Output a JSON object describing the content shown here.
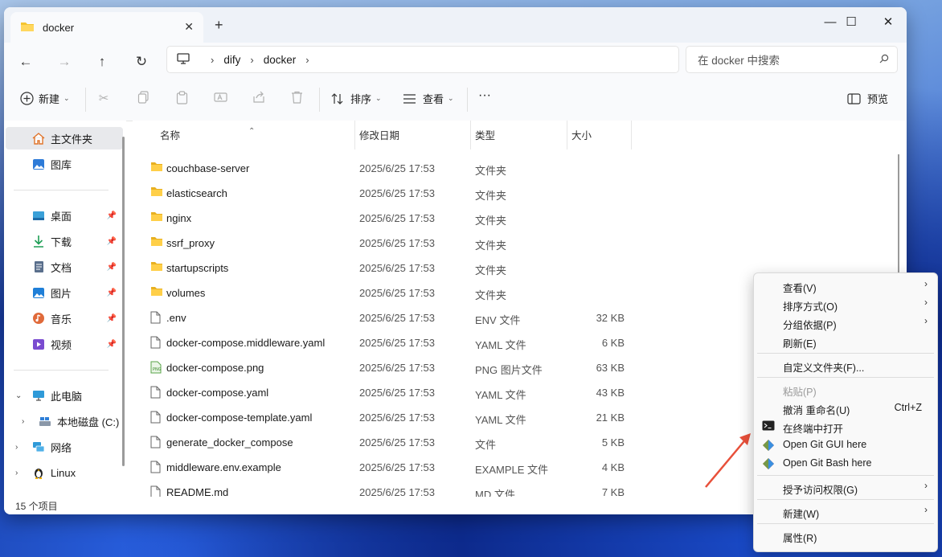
{
  "tab": {
    "title": "docker",
    "close": "✕",
    "new": "+"
  },
  "window_controls": {
    "minimize": "—",
    "maximize": "☐",
    "close": "✕"
  },
  "nav": {
    "back": "←",
    "forward": "→",
    "up": "↑",
    "refresh": "↻"
  },
  "breadcrumb": {
    "sep": "›",
    "items": [
      "dify",
      "docker"
    ]
  },
  "search": {
    "placeholder": "在 docker 中搜索"
  },
  "toolbar": {
    "new_label": "新建",
    "sort_label": "排序",
    "view_label": "查看",
    "more": "···",
    "preview_label": "预览",
    "caret": "⌄"
  },
  "sidebar": {
    "home": "主文件夹",
    "gallery": "图库",
    "desktop": "桌面",
    "downloads": "下载",
    "documents": "文档",
    "pictures": "图片",
    "music": "音乐",
    "videos": "视频",
    "this_pc": "此电脑",
    "local_disk": "本地磁盘 (C:)",
    "network": "网络",
    "linux": "Linux"
  },
  "columns": {
    "name": "名称",
    "date": "修改日期",
    "type": "类型",
    "size": "大小"
  },
  "files": [
    {
      "name": "couchbase-server",
      "date": "2025/6/25 17:53",
      "type": "文件夹",
      "size": ""
    },
    {
      "name": "elasticsearch",
      "date": "2025/6/25 17:53",
      "type": "文件夹",
      "size": ""
    },
    {
      "name": "nginx",
      "date": "2025/6/25 17:53",
      "type": "文件夹",
      "size": ""
    },
    {
      "name": "ssrf_proxy",
      "date": "2025/6/25 17:53",
      "type": "文件夹",
      "size": ""
    },
    {
      "name": "startupscripts",
      "date": "2025/6/25 17:53",
      "type": "文件夹",
      "size": ""
    },
    {
      "name": "volumes",
      "date": "2025/6/25 17:53",
      "type": "文件夹",
      "size": ""
    },
    {
      "name": ".env",
      "date": "2025/6/25 17:53",
      "type": "ENV 文件",
      "size": "32 KB"
    },
    {
      "name": "docker-compose.middleware.yaml",
      "date": "2025/6/25 17:53",
      "type": "YAML 文件",
      "size": "6 KB"
    },
    {
      "name": "docker-compose.png",
      "date": "2025/6/25 17:53",
      "type": "PNG 图片文件",
      "size": "63 KB"
    },
    {
      "name": "docker-compose.yaml",
      "date": "2025/6/25 17:53",
      "type": "YAML 文件",
      "size": "43 KB"
    },
    {
      "name": "docker-compose-template.yaml",
      "date": "2025/6/25 17:53",
      "type": "YAML 文件",
      "size": "21 KB"
    },
    {
      "name": "generate_docker_compose",
      "date": "2025/6/25 17:53",
      "type": "文件",
      "size": "5 KB"
    },
    {
      "name": "middleware.env.example",
      "date": "2025/6/25 17:53",
      "type": "EXAMPLE 文件",
      "size": "4 KB"
    },
    {
      "name": "README.md",
      "date": "2025/6/25 17:53",
      "type": "MD 文件",
      "size": "7 KB"
    }
  ],
  "status": {
    "count": "15 个项目"
  },
  "context_menu": {
    "submenu_arrow": "›",
    "view": "查看(V)",
    "sort_by": "排序方式(O)",
    "group_by": "分组依据(P)",
    "refresh": "刷新(E)",
    "customize": "自定义文件夹(F)...",
    "paste": "粘贴(P)",
    "undo_rename": "撤消 重命名(U)",
    "undo_shortcut": "Ctrl+Z",
    "open_terminal": "在终端中打开",
    "git_gui": "Open Git GUI here",
    "git_bash": "Open Git Bash here",
    "grant_access": "授予访问权限(G)",
    "new": "新建(W)",
    "properties": "属性(R)"
  },
  "colors": {
    "folder": "#f4c430",
    "annotation_arrow": "#e8503a",
    "accent": "#0067c0"
  }
}
